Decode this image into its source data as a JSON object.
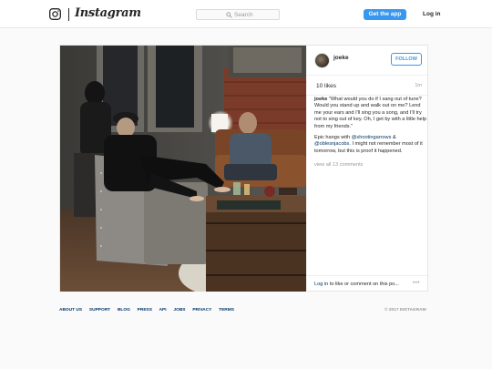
{
  "header": {
    "brand": "Instagram",
    "search_placeholder": "Search",
    "get_app_label": "Get the app",
    "login_label": "Log in"
  },
  "post": {
    "author": "joeke",
    "follow_label": "FOLLOW",
    "likes": "10 likes",
    "time": "1m",
    "caption_author": "joeke",
    "caption_text": "\"What would you do if I sang out of tune? Would you stand up and walk out on me? Lend me your ears and I'll sing you a song, and I'll try not to sing out of key. Oh, I get by with a little help from my friends.\"",
    "caption2_prefix": "Epic hangs with",
    "mention1": "@shootingarrows",
    "amp": "&",
    "mention2": "@oblesnjacobs",
    "caption2_suffix": ". I might not remember most of it tomorrow, but this is proof it happened.",
    "view_all": "view all 13 comments",
    "comment_prompt_link": "Log in",
    "comment_prompt_text": "to like or comment on this po...",
    "more_icon": "more-options-icon"
  },
  "footer": {
    "links": [
      "ABOUT US",
      "SUPPORT",
      "BLOG",
      "PRESS",
      "API",
      "JOBS",
      "PRIVACY",
      "TERMS"
    ],
    "copyright": "© 2017 INSTAGRAM"
  },
  "colors": {
    "accent": "#3897f0",
    "link": "#003569",
    "muted": "#999999",
    "text": "#262626"
  }
}
